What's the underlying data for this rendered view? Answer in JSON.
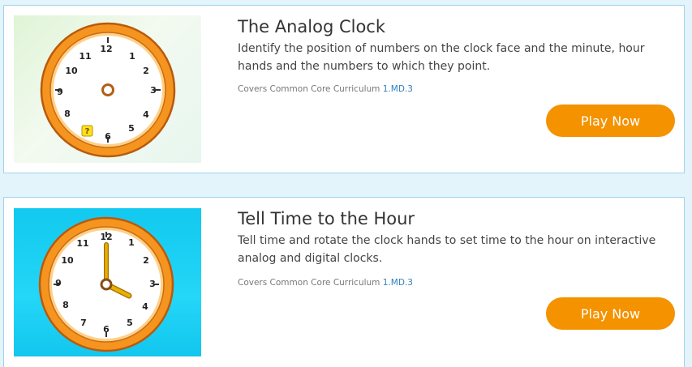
{
  "games": [
    {
      "title": "The Analog Clock",
      "description": "Identify the position of numbers on the clock face and the minute, hour hands and the numbers to which they point.",
      "standard_prefix": "Covers Common Core Curriculum",
      "standard_code": "1.MD.3",
      "button_label": "Play Now",
      "thumbnail": {
        "clock_numbers": [
          "12",
          "1",
          "2",
          "3",
          "4",
          "5",
          "6",
          "",
          "8",
          "9",
          "10",
          "11"
        ],
        "missing_marker": "?",
        "shows_hands": false
      }
    },
    {
      "title": "Tell Time to the Hour",
      "description": "Tell time and rotate the clock hands to set time to the hour on interactive analog and digital clocks.",
      "standard_prefix": "Covers Common Core Curriculum",
      "standard_code": "1.MD.3",
      "button_label": "Play Now",
      "thumbnail": {
        "clock_numbers": [
          "12",
          "1",
          "2",
          "3",
          "4",
          "5",
          "6",
          "7",
          "8",
          "9",
          "10",
          "11"
        ],
        "shows_hands": true,
        "time_shown": "4:00"
      }
    }
  ],
  "colors": {
    "button": "#f49200",
    "card_border": "#9fd3ea",
    "page_background": "#e3f4fb",
    "link": "#2f7fbf",
    "clock_rim": "#e8801a",
    "clock_hands": "#e0a400"
  }
}
